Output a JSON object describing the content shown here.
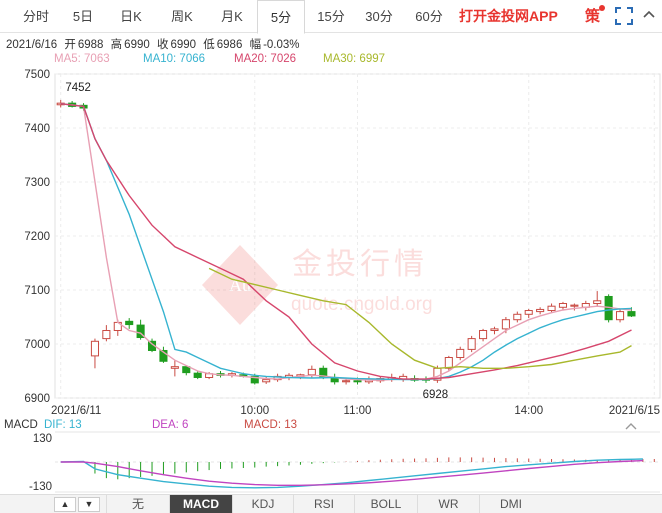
{
  "tabs": [
    {
      "label": "分时",
      "active": false
    },
    {
      "label": "5日",
      "active": false
    },
    {
      "label": "日K",
      "active": false
    },
    {
      "label": "周K",
      "active": false
    },
    {
      "label": "月K",
      "active": false
    },
    {
      "label": "5分",
      "active": true
    },
    {
      "label": "15分",
      "active": false
    },
    {
      "label": "30分",
      "active": false
    },
    {
      "label": "60分",
      "active": false
    }
  ],
  "app_link": "打开金投网APP",
  "ce_label": "策",
  "info": {
    "date": "2021/6/16",
    "open_label": "开",
    "open": "6988",
    "high_label": "高",
    "high": "6990",
    "close_label": "收",
    "close": "6990",
    "low_label": "低",
    "low": "6986",
    "change_label": "幅",
    "change": "-0.03%"
  },
  "ma_legend": [
    {
      "label": "MA5: 7063",
      "color": "#e8a0b4"
    },
    {
      "label": "MA10: 7066",
      "color": "#36b3d0"
    },
    {
      "label": "MA20: 7026",
      "color": "#d6466c"
    },
    {
      "label": "MA30: 6997",
      "color": "#a8b82c"
    }
  ],
  "watermark": {
    "brand": "金投行情",
    "url": "quote.cngold.org",
    "logo_text": "Au"
  },
  "colors": {
    "up": "#c94b43",
    "down": "#1f9d1f",
    "grid": "#ececec",
    "axis_text": "#333"
  },
  "macd_legend": {
    "title": "MACD",
    "dif": "DIF: 13",
    "dif_color": "#36b3d0",
    "dea": "DEA: 6",
    "dea_color": "#c044c0",
    "macd": "MACD: 13",
    "macd_color": "#c94b43"
  },
  "indicator_tabs": [
    {
      "label": "无",
      "active": false
    },
    {
      "label": "MACD",
      "active": true
    },
    {
      "label": "KDJ",
      "active": false
    },
    {
      "label": "RSI",
      "active": false
    },
    {
      "label": "BOLL",
      "active": false
    },
    {
      "label": "WR",
      "active": false
    },
    {
      "label": "DMI",
      "active": false
    }
  ],
  "arrow_up": "▲",
  "arrow_down": "▼",
  "chart_data": {
    "type": "candlestick",
    "ylim": [
      6900,
      7500
    ],
    "y_ticks": [
      7500,
      7400,
      7300,
      7200,
      7100,
      7000,
      6900
    ],
    "x_labels": [
      {
        "index": 0,
        "label": "2021/6/11"
      },
      {
        "index": 17,
        "label": "10:00"
      },
      {
        "index": 26,
        "label": "11:00"
      },
      {
        "index": 41,
        "label": "14:00"
      },
      {
        "index": 52,
        "label": "2021/6/15"
      }
    ],
    "annotations": [
      {
        "index": 1,
        "value": 7452,
        "label": "7452"
      },
      {
        "index": 33,
        "value": 6928,
        "label": "6928"
      }
    ],
    "candles": [
      {
        "o": 7443,
        "h": 7452,
        "l": 7438,
        "c": 7446
      },
      {
        "o": 7446,
        "h": 7450,
        "l": 7438,
        "c": 7440
      },
      {
        "o": 7442,
        "h": 7446,
        "l": 7432,
        "c": 7437
      },
      {
        "o": 6978,
        "h": 7010,
        "l": 6955,
        "c": 7005
      },
      {
        "o": 7010,
        "h": 7035,
        "l": 7005,
        "c": 7025
      },
      {
        "o": 7025,
        "h": 7045,
        "l": 7015,
        "c": 7040
      },
      {
        "o": 7042,
        "h": 7048,
        "l": 7028,
        "c": 7036
      },
      {
        "o": 7035,
        "h": 7045,
        "l": 7008,
        "c": 7012
      },
      {
        "o": 7005,
        "h": 7010,
        "l": 6985,
        "c": 6988
      },
      {
        "o": 6988,
        "h": 6995,
        "l": 6965,
        "c": 6968
      },
      {
        "o": 6955,
        "h": 6970,
        "l": 6940,
        "c": 6958
      },
      {
        "o": 6958,
        "h": 6960,
        "l": 6942,
        "c": 6947
      },
      {
        "o": 6946,
        "h": 6950,
        "l": 6935,
        "c": 6938
      },
      {
        "o": 6938,
        "h": 6948,
        "l": 6935,
        "c": 6945
      },
      {
        "o": 6945,
        "h": 6950,
        "l": 6938,
        "c": 6942
      },
      {
        "o": 6942,
        "h": 6948,
        "l": 6938,
        "c": 6945
      },
      {
        "o": 6943,
        "h": 6947,
        "l": 6938,
        "c": 6940
      },
      {
        "o": 6940,
        "h": 6945,
        "l": 6925,
        "c": 6928
      },
      {
        "o": 6930,
        "h": 6940,
        "l": 6926,
        "c": 6934
      },
      {
        "o": 6934,
        "h": 6945,
        "l": 6930,
        "c": 6940
      },
      {
        "o": 6938,
        "h": 6946,
        "l": 6933,
        "c": 6942
      },
      {
        "o": 6940,
        "h": 6945,
        "l": 6935,
        "c": 6943
      },
      {
        "o": 6943,
        "h": 6960,
        "l": 6938,
        "c": 6953
      },
      {
        "o": 6955,
        "h": 6960,
        "l": 6935,
        "c": 6938
      },
      {
        "o": 6938,
        "h": 6945,
        "l": 6925,
        "c": 6930
      },
      {
        "o": 6930,
        "h": 6938,
        "l": 6925,
        "c": 6932
      },
      {
        "o": 6932,
        "h": 6938,
        "l": 6925,
        "c": 6930
      },
      {
        "o": 6930,
        "h": 6940,
        "l": 6926,
        "c": 6935
      },
      {
        "o": 6932,
        "h": 6940,
        "l": 6928,
        "c": 6936
      },
      {
        "o": 6935,
        "h": 6945,
        "l": 6930,
        "c": 6938
      },
      {
        "o": 6935,
        "h": 6945,
        "l": 6930,
        "c": 6940
      },
      {
        "o": 6936,
        "h": 6942,
        "l": 6930,
        "c": 6933
      },
      {
        "o": 6935,
        "h": 6940,
        "l": 6928,
        "c": 6933
      },
      {
        "o": 6933,
        "h": 6960,
        "l": 6928,
        "c": 6955
      },
      {
        "o": 6955,
        "h": 6978,
        "l": 6950,
        "c": 6975
      },
      {
        "o": 6975,
        "h": 6995,
        "l": 6970,
        "c": 6990
      },
      {
        "o": 6990,
        "h": 7015,
        "l": 6985,
        "c": 7010
      },
      {
        "o": 7010,
        "h": 7028,
        "l": 7005,
        "c": 7025
      },
      {
        "o": 7025,
        "h": 7032,
        "l": 7018,
        "c": 7028
      },
      {
        "o": 7028,
        "h": 7050,
        "l": 7020,
        "c": 7045
      },
      {
        "o": 7045,
        "h": 7060,
        "l": 7040,
        "c": 7055
      },
      {
        "o": 7055,
        "h": 7065,
        "l": 7048,
        "c": 7062
      },
      {
        "o": 7060,
        "h": 7068,
        "l": 7055,
        "c": 7064
      },
      {
        "o": 7062,
        "h": 7075,
        "l": 7058,
        "c": 7070
      },
      {
        "o": 7068,
        "h": 7078,
        "l": 7062,
        "c": 7075
      },
      {
        "o": 7070,
        "h": 7075,
        "l": 7062,
        "c": 7072
      },
      {
        "o": 7068,
        "h": 7080,
        "l": 7062,
        "c": 7075
      },
      {
        "o": 7075,
        "h": 7098,
        "l": 7070,
        "c": 7080
      },
      {
        "o": 7088,
        "h": 7092,
        "l": 7040,
        "c": 7045
      },
      {
        "o": 7045,
        "h": 7065,
        "l": 7040,
        "c": 7060
      },
      {
        "o": 7060,
        "h": 7068,
        "l": 7050,
        "c": 7052
      }
    ],
    "series": [
      {
        "name": "MA5",
        "color": "#e8a0b4",
        "points": [
          [
            0,
            7445
          ],
          [
            1,
            7443
          ],
          [
            2,
            7440
          ],
          [
            3,
            7300
          ],
          [
            4,
            7160
          ],
          [
            5,
            7040
          ],
          [
            6,
            7025
          ],
          [
            7,
            7020
          ],
          [
            8,
            7000
          ],
          [
            9,
            6985
          ],
          [
            10,
            6970
          ],
          [
            11,
            6960
          ],
          [
            12,
            6950
          ],
          [
            13,
            6945
          ],
          [
            14,
            6943
          ],
          [
            15,
            6942
          ],
          [
            16,
            6940
          ],
          [
            17,
            6938
          ],
          [
            18,
            6936
          ],
          [
            19,
            6935
          ],
          [
            20,
            6938
          ],
          [
            21,
            6940
          ],
          [
            22,
            6942
          ],
          [
            23,
            6941
          ],
          [
            24,
            6938
          ],
          [
            25,
            6935
          ],
          [
            26,
            6934
          ],
          [
            27,
            6933
          ],
          [
            28,
            6933
          ],
          [
            29,
            6934
          ],
          [
            30,
            6935
          ],
          [
            31,
            6935
          ],
          [
            32,
            6935
          ],
          [
            33,
            6940
          ],
          [
            34,
            6950
          ],
          [
            35,
            6965
          ],
          [
            36,
            6980
          ],
          [
            37,
            6995
          ],
          [
            38,
            7010
          ],
          [
            39,
            7025
          ],
          [
            40,
            7035
          ],
          [
            41,
            7045
          ],
          [
            42,
            7052
          ],
          [
            43,
            7058
          ],
          [
            44,
            7063
          ],
          [
            45,
            7066
          ],
          [
            46,
            7068
          ],
          [
            47,
            7070
          ],
          [
            48,
            7068
          ],
          [
            49,
            7065
          ],
          [
            50,
            7063
          ]
        ]
      },
      {
        "name": "MA10",
        "color": "#36b3d0",
        "points": [
          [
            0,
            7445
          ],
          [
            2,
            7440
          ],
          [
            3,
            7380
          ],
          [
            4,
            7340
          ],
          [
            5,
            7290
          ],
          [
            6,
            7240
          ],
          [
            7,
            7180
          ],
          [
            8,
            7120
          ],
          [
            9,
            7060
          ],
          [
            10,
            6990
          ],
          [
            11,
            6985
          ],
          [
            12,
            6975
          ],
          [
            13,
            6965
          ],
          [
            14,
            6955
          ],
          [
            15,
            6950
          ],
          [
            16,
            6945
          ],
          [
            17,
            6942
          ],
          [
            18,
            6940
          ],
          [
            20,
            6938
          ],
          [
            22,
            6937
          ],
          [
            24,
            6938
          ],
          [
            26,
            6936
          ],
          [
            28,
            6935
          ],
          [
            30,
            6934
          ],
          [
            32,
            6934
          ],
          [
            33,
            6936
          ],
          [
            34,
            6940
          ],
          [
            35,
            6948
          ],
          [
            36,
            6958
          ],
          [
            37,
            6970
          ],
          [
            38,
            6985
          ],
          [
            39,
            6998
          ],
          [
            40,
            7010
          ],
          [
            41,
            7020
          ],
          [
            42,
            7030
          ],
          [
            43,
            7038
          ],
          [
            44,
            7045
          ],
          [
            45,
            7050
          ],
          [
            46,
            7055
          ],
          [
            47,
            7060
          ],
          [
            48,
            7063
          ],
          [
            49,
            7065
          ],
          [
            50,
            7066
          ]
        ]
      },
      {
        "name": "MA20",
        "color": "#d6466c",
        "points": [
          [
            0,
            7445
          ],
          [
            2,
            7440
          ],
          [
            3,
            7380
          ],
          [
            4,
            7340
          ],
          [
            6,
            7275
          ],
          [
            8,
            7220
          ],
          [
            10,
            7180
          ],
          [
            12,
            7160
          ],
          [
            14,
            7140
          ],
          [
            16,
            7120
          ],
          [
            18,
            7080
          ],
          [
            20,
            7050
          ],
          [
            22,
            7000
          ],
          [
            24,
            6965
          ],
          [
            26,
            6950
          ],
          [
            28,
            6940
          ],
          [
            30,
            6935
          ],
          [
            32,
            6935
          ],
          [
            34,
            6938
          ],
          [
            36,
            6945
          ],
          [
            38,
            6952
          ],
          [
            40,
            6960
          ],
          [
            42,
            6970
          ],
          [
            44,
            6980
          ],
          [
            46,
            6992
          ],
          [
            48,
            7005
          ],
          [
            50,
            7026
          ]
        ]
      },
      {
        "name": "MA30",
        "color": "#a8b82c",
        "points": [
          [
            13,
            7140
          ],
          [
            15,
            7120
          ],
          [
            17,
            7110
          ],
          [
            19,
            7100
          ],
          [
            21,
            7090
          ],
          [
            23,
            7080
          ],
          [
            25,
            7073
          ],
          [
            27,
            7040
          ],
          [
            29,
            7000
          ],
          [
            31,
            6970
          ],
          [
            33,
            6955
          ],
          [
            35,
            6958
          ],
          [
            37,
            6955
          ],
          [
            39,
            6955
          ],
          [
            41,
            6958
          ],
          [
            43,
            6962
          ],
          [
            45,
            6970
          ],
          [
            47,
            6978
          ],
          [
            49,
            6985
          ],
          [
            50,
            6997
          ]
        ]
      }
    ],
    "macd": {
      "ylim": [
        -130,
        130
      ],
      "y_ticks": [
        130,
        -130
      ],
      "dif": [
        [
          0,
          0
        ],
        [
          2,
          2
        ],
        [
          3,
          -30
        ],
        [
          5,
          -55
        ],
        [
          7,
          -70
        ],
        [
          9,
          -85
        ],
        [
          11,
          -95
        ],
        [
          13,
          -105
        ],
        [
          15,
          -110
        ],
        [
          17,
          -112
        ],
        [
          19,
          -110
        ],
        [
          21,
          -105
        ],
        [
          23,
          -98
        ],
        [
          25,
          -90
        ],
        [
          27,
          -80
        ],
        [
          29,
          -70
        ],
        [
          31,
          -60
        ],
        [
          33,
          -50
        ],
        [
          35,
          -40
        ],
        [
          37,
          -30
        ],
        [
          39,
          -20
        ],
        [
          41,
          -12
        ],
        [
          43,
          -5
        ],
        [
          45,
          2
        ],
        [
          47,
          8
        ],
        [
          49,
          11
        ],
        [
          51,
          13
        ]
      ],
      "dea": [
        [
          0,
          0
        ],
        [
          2,
          0
        ],
        [
          3,
          -5
        ],
        [
          5,
          -20
        ],
        [
          7,
          -38
        ],
        [
          9,
          -55
        ],
        [
          11,
          -70
        ],
        [
          13,
          -83
        ],
        [
          15,
          -92
        ],
        [
          17,
          -98
        ],
        [
          19,
          -101
        ],
        [
          21,
          -101
        ],
        [
          23,
          -99
        ],
        [
          25,
          -95
        ],
        [
          27,
          -90
        ],
        [
          29,
          -83
        ],
        [
          31,
          -75
        ],
        [
          33,
          -66
        ],
        [
          35,
          -57
        ],
        [
          37,
          -48
        ],
        [
          39,
          -38
        ],
        [
          41,
          -28
        ],
        [
          43,
          -19
        ],
        [
          45,
          -10
        ],
        [
          47,
          -3
        ],
        [
          49,
          2
        ],
        [
          51,
          6
        ]
      ],
      "hist": [
        0,
        2,
        3,
        -50,
        -70,
        -75,
        -70,
        -65,
        -60,
        -55,
        -50,
        -45,
        -40,
        -35,
        -30,
        -28,
        -26,
        -24,
        -20,
        -18,
        -15,
        -12,
        -8,
        -5,
        -2,
        2,
        5,
        8,
        10,
        12,
        14,
        15,
        16,
        18,
        20,
        20,
        20,
        19,
        18,
        17,
        16,
        15,
        14,
        13,
        12,
        11,
        10,
        10,
        11,
        12,
        13,
        13,
        13
      ]
    }
  }
}
